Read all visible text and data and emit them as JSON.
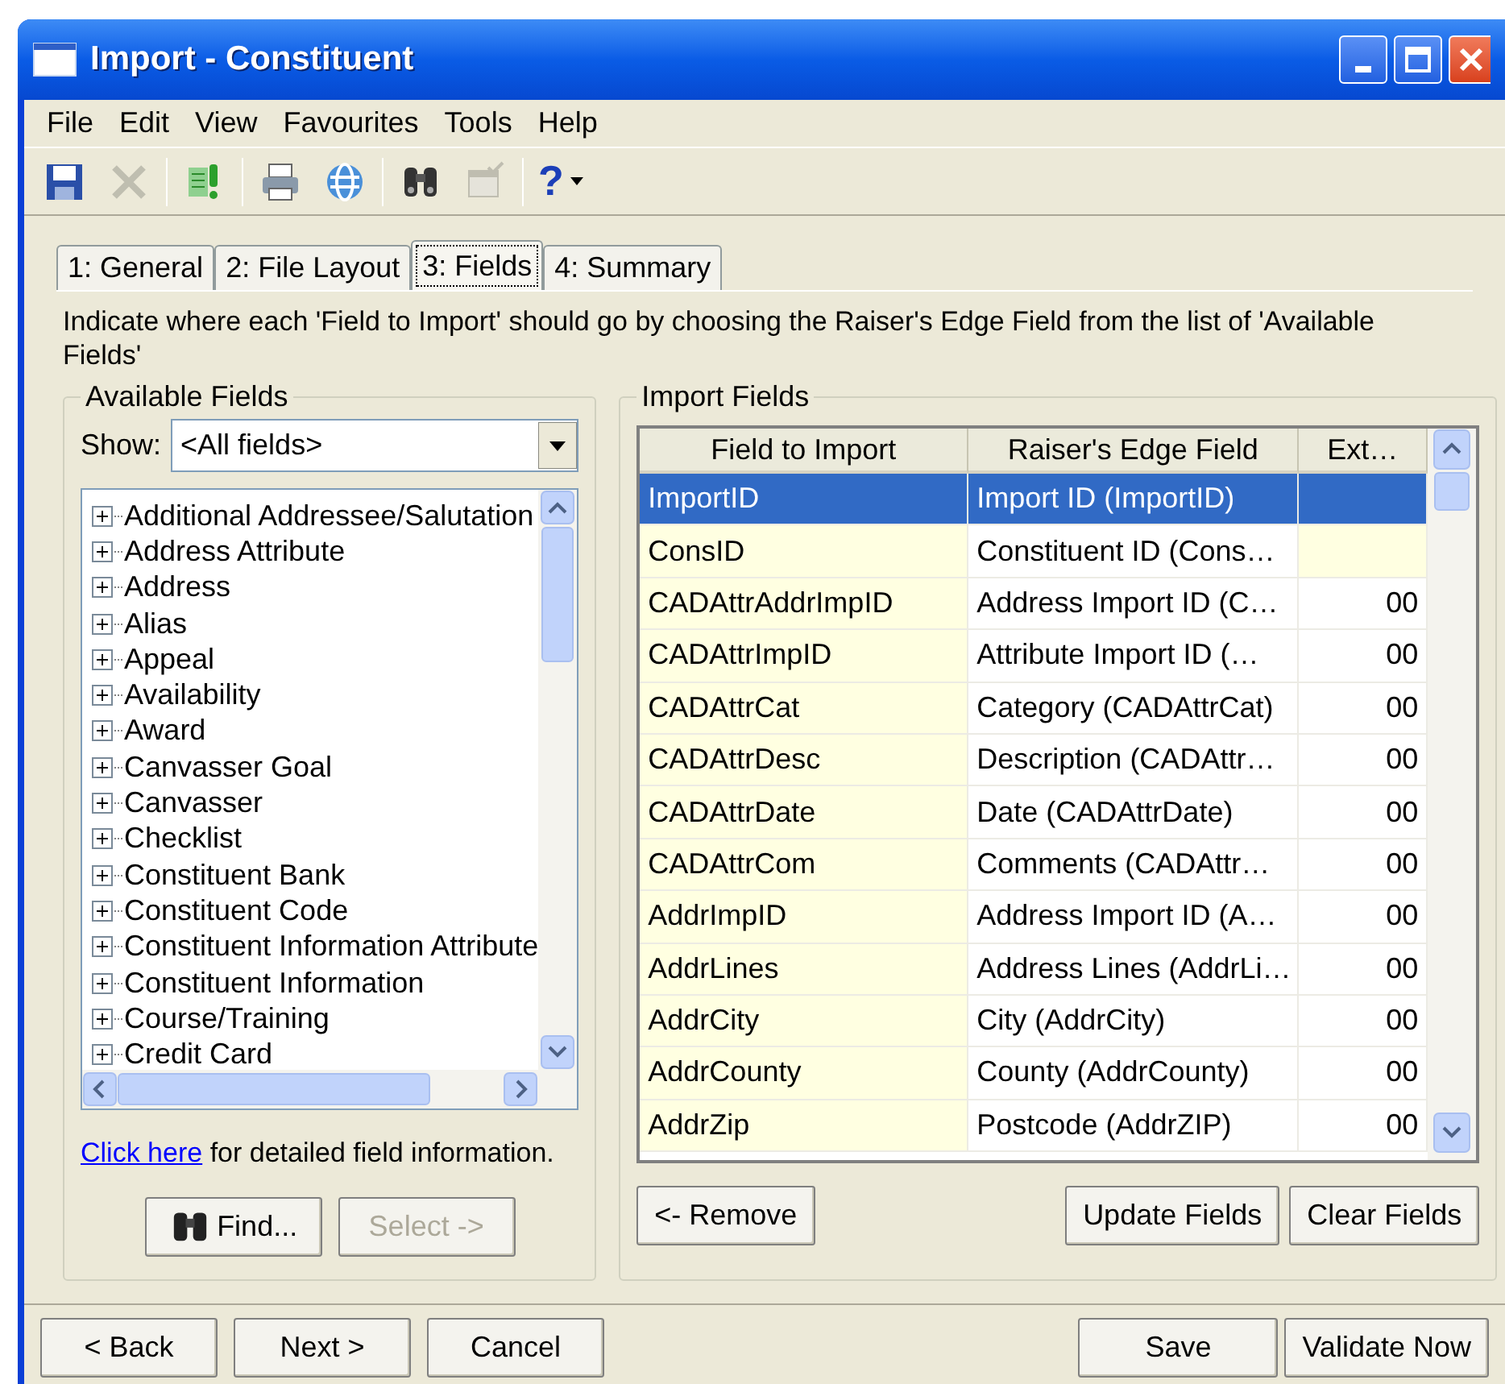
{
  "window": {
    "title": "Import - Constituent"
  },
  "menu": [
    {
      "label": "File"
    },
    {
      "label": "Edit"
    },
    {
      "label": "View"
    },
    {
      "label": "Favourites"
    },
    {
      "label": "Tools"
    },
    {
      "label": "Help"
    }
  ],
  "toolbar": [
    {
      "kind": "save",
      "disabled": false
    },
    {
      "kind": "delete",
      "disabled": true
    },
    {
      "kind": "sep"
    },
    {
      "kind": "run",
      "disabled": false
    },
    {
      "kind": "sep"
    },
    {
      "kind": "print",
      "disabled": false
    },
    {
      "kind": "web",
      "disabled": false
    },
    {
      "kind": "sep"
    },
    {
      "kind": "find",
      "disabled": false
    },
    {
      "kind": "properties",
      "disabled": true
    },
    {
      "kind": "sep"
    },
    {
      "kind": "help",
      "label": "?",
      "disabled": false
    }
  ],
  "tabs": [
    {
      "label": "1: General",
      "selected": false
    },
    {
      "label": "2: File Layout",
      "selected": false
    },
    {
      "label": "3: Fields",
      "selected": true
    },
    {
      "label": "4: Summary",
      "selected": false
    }
  ],
  "instruction": "Indicate where each 'Field to Import' should go by choosing the Raiser's Edge Field from the list of 'Available Fields'",
  "available_fields": {
    "title": "Available Fields",
    "show_label": "Show:",
    "show_value": "<All fields>",
    "items": [
      {
        "label": "Additional Addressee/Salutation",
        "expanded": false
      },
      {
        "label": "Address Attribute",
        "expanded": false
      },
      {
        "label": "Address",
        "expanded": false
      },
      {
        "label": "Alias",
        "expanded": false
      },
      {
        "label": "Appeal",
        "expanded": false
      },
      {
        "label": "Availability",
        "expanded": false
      },
      {
        "label": "Award",
        "expanded": false
      },
      {
        "label": "Canvasser Goal",
        "expanded": false
      },
      {
        "label": "Canvasser",
        "expanded": false
      },
      {
        "label": "Checklist",
        "expanded": false
      },
      {
        "label": "Constituent Bank",
        "expanded": false
      },
      {
        "label": "Constituent Code",
        "expanded": false
      },
      {
        "label": "Constituent Information Attribute",
        "expanded": false
      },
      {
        "label": "Constituent Information",
        "expanded": false
      },
      {
        "label": "Course/Training",
        "expanded": false
      },
      {
        "label": "Credit Card",
        "expanded": false
      }
    ],
    "link": "Click here",
    "link_rest": " for detailed field information.",
    "buttons": [
      {
        "label": "Find...",
        "kind": "find",
        "disabled": false
      },
      {
        "label": "Select ->",
        "kind": "plain",
        "disabled": true
      }
    ]
  },
  "import_fields": {
    "title": "Import Fields",
    "columns": [
      "Field to Import",
      "Raiser's Edge Field",
      "Ext…"
    ],
    "rows": [
      {
        "cells": [
          "ImportID",
          "Import ID (ImportID)",
          ""
        ],
        "selected": true
      },
      {
        "cells": [
          "ConsID",
          "Constituent ID (Cons…",
          ""
        ],
        "selected": false
      },
      {
        "cells": [
          "CADAttrAddrImpID",
          "Address Import ID (C…",
          "00"
        ],
        "selected": false
      },
      {
        "cells": [
          "CADAttrImpID",
          "Attribute Import ID (…",
          "00"
        ],
        "selected": false
      },
      {
        "cells": [
          "CADAttrCat",
          "Category (CADAttrCat)",
          "00"
        ],
        "selected": false
      },
      {
        "cells": [
          "CADAttrDesc",
          "Description (CADAttr…",
          "00"
        ],
        "selected": false
      },
      {
        "cells": [
          "CADAttrDate",
          "Date (CADAttrDate)",
          "00"
        ],
        "selected": false
      },
      {
        "cells": [
          "CADAttrCom",
          "Comments (CADAttr…",
          "00"
        ],
        "selected": false
      },
      {
        "cells": [
          "AddrImpID",
          "Address Import ID (A…",
          "00"
        ],
        "selected": false
      },
      {
        "cells": [
          "AddrLines",
          "Address Lines (AddrLi…",
          "00"
        ],
        "selected": false
      },
      {
        "cells": [
          "AddrCity",
          "City (AddrCity)",
          "00"
        ],
        "selected": false
      },
      {
        "cells": [
          "AddrCounty",
          "County (AddrCounty)",
          "00"
        ],
        "selected": false
      },
      {
        "cells": [
          "AddrZip",
          "Postcode (AddrZIP)",
          "00"
        ],
        "selected": false
      }
    ],
    "left_buttons": [
      {
        "label": "<- Remove"
      }
    ],
    "right_buttons": [
      {
        "label": "Update Fields"
      },
      {
        "label": "Clear Fields"
      }
    ]
  },
  "footer_left": [
    {
      "label": "< Back"
    },
    {
      "label": "Next >"
    },
    {
      "label": "Cancel"
    }
  ],
  "footer_right": [
    {
      "label": "Save"
    },
    {
      "label": "Validate Now"
    }
  ]
}
